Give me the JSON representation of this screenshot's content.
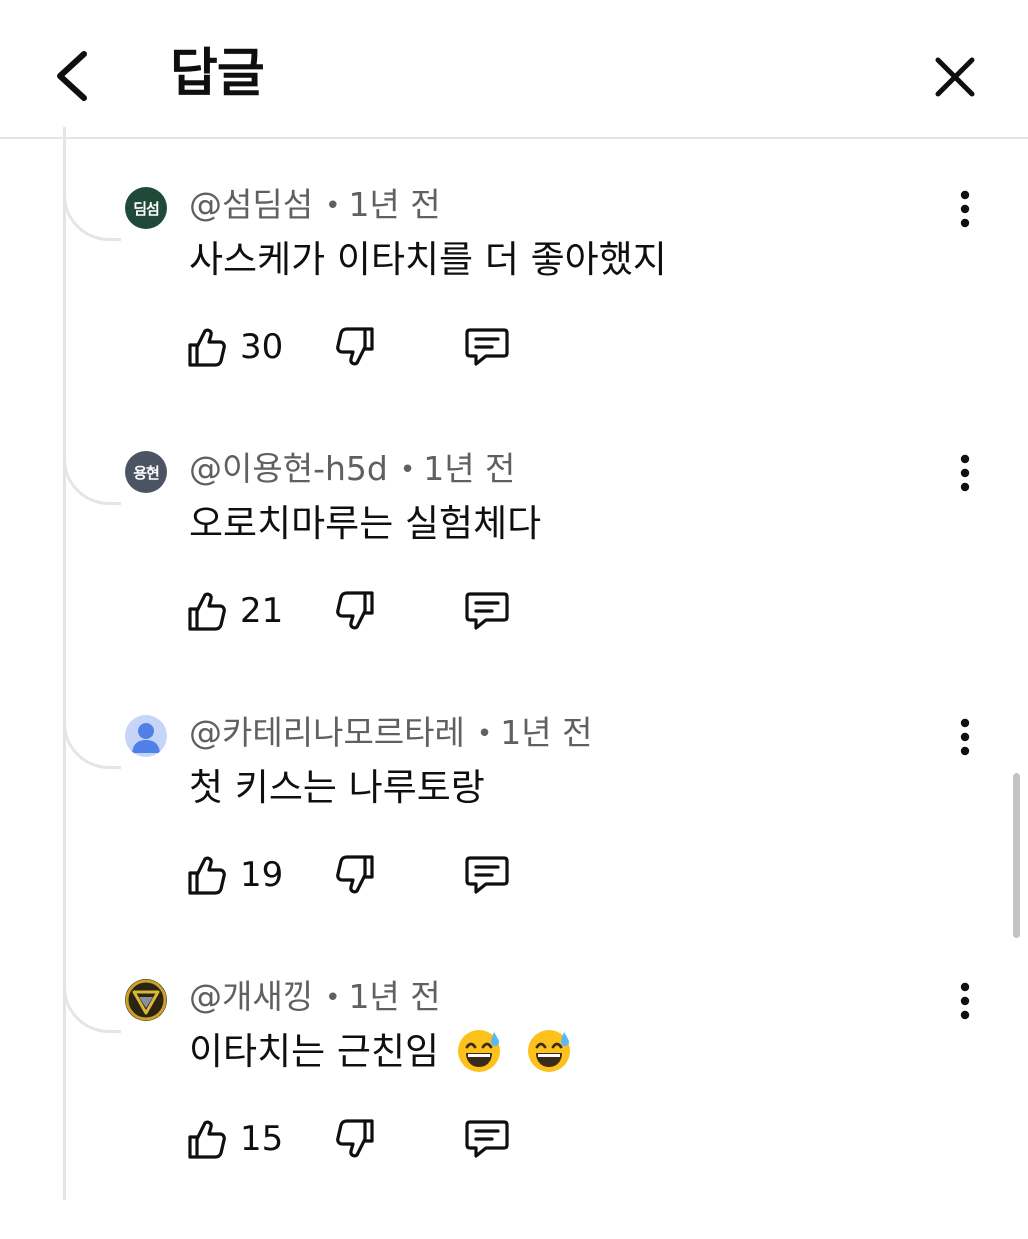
{
  "header": {
    "title": "답글"
  },
  "replies": [
    {
      "avatar_text": "딤섬",
      "avatar_color": "#1f4a3a",
      "username": "@섬딤섬",
      "time": "1년 전",
      "text": "사스케가 이타치를 더 좋아했지",
      "likes": "30"
    },
    {
      "avatar_text": "용현",
      "avatar_color": "#4a5462",
      "username": "@이용현-h5d",
      "time": "1년 전",
      "text": "오로치마루는 실험체다",
      "likes": "21"
    },
    {
      "avatar_text": "",
      "avatar_color": "#c6d4f7",
      "username": "@카테리나모르타레",
      "time": "1년 전",
      "text": "첫 키스는 나루토랑",
      "likes": "19"
    },
    {
      "avatar_text": "",
      "avatar_color": "#1c1c1c",
      "username": "@개새낑",
      "time": "1년 전",
      "text": "이타치는 근친임",
      "likes": "15"
    }
  ],
  "separator": "•",
  "colors": {
    "primary_text": "#0f0f0f",
    "secondary_text": "#606060",
    "divider": "#e5e5e5",
    "scrollbar": "#c4c4c4"
  },
  "icons": [
    "back-icon",
    "close-icon",
    "more-vert-icon",
    "thumb-up-icon",
    "thumb-down-icon",
    "comment-icon",
    "default-avatar-icon",
    "sweat-smile-emoji"
  ]
}
